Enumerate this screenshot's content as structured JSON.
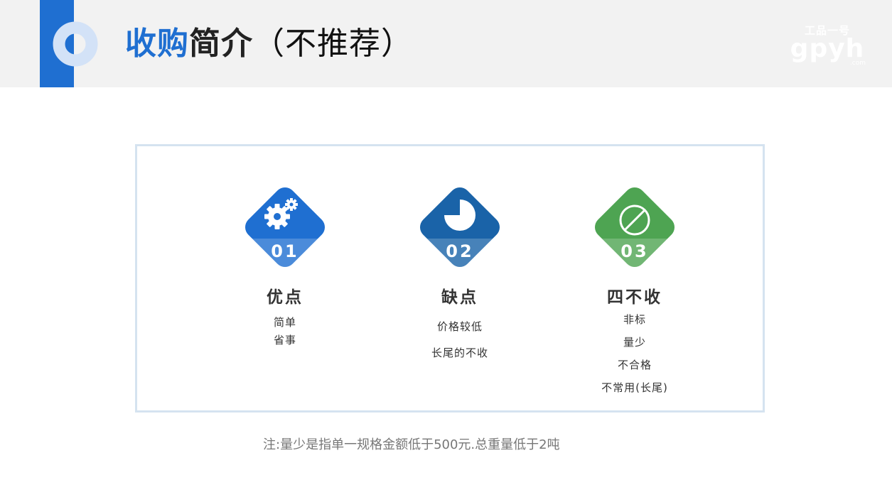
{
  "header": {
    "title_highlight": "收购",
    "title_main": "简介",
    "title_sub": "（不推荐）",
    "accent_color": "#1f6fd1",
    "logo": {
      "cn": "工品一号",
      "en": "gpyh",
      "suffix": ".com"
    }
  },
  "features": [
    {
      "number": "01",
      "title": "优点",
      "items": [
        "简单",
        "省事"
      ],
      "icon": "gears-icon",
      "color": "#1f6fd1"
    },
    {
      "number": "02",
      "title": "缺点",
      "items": [
        "价格较低",
        "长尾的不收"
      ],
      "icon": "pie-chart-icon",
      "color": "#1a63a8"
    },
    {
      "number": "03",
      "title": "四不收",
      "items": [
        "非标",
        "量少",
        "不合格",
        "不常用(长尾)"
      ],
      "icon": "prohibited-icon",
      "color": "#4ea452"
    }
  ],
  "note": "注:量少是指单一规格金额低于500元.总重量低于2吨"
}
